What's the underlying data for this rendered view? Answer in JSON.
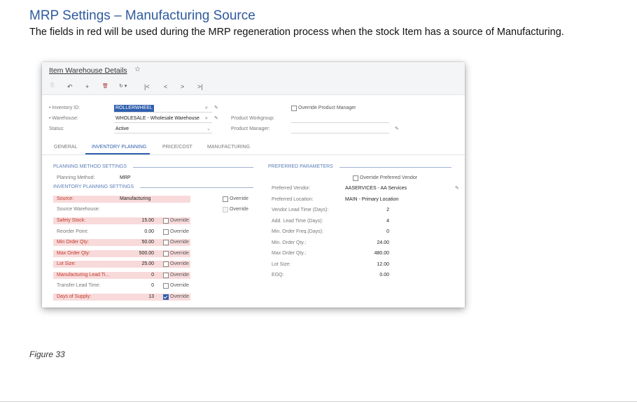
{
  "doc": {
    "title": "MRP Settings – Manufacturing Source",
    "description": "The fields in red will be used during the MRP regeneration process when the stock Item has a source of Manufacturing.",
    "figure_caption": "Figure 33"
  },
  "screen": {
    "title": "Item Warehouse Details",
    "toolbar": [
      "⎘",
      "↶",
      "+",
      "🗑",
      "↻ ▾",
      "|<",
      "<",
      ">",
      ">|"
    ]
  },
  "header_fields": {
    "inventory_id_label": "• Inventory ID:",
    "inventory_id_value": "ROLLERWHEEL",
    "warehouse_label": "• Warehouse:",
    "warehouse_value": "WHOLESALE - Wholesale Warehouse",
    "status_label": "Status:",
    "status_value": "Active",
    "override_product_manager": "Override Product Manager",
    "product_workgroup_label": "Product Workgroup:",
    "product_manager_label": "Product Manager:"
  },
  "tabs": [
    "GENERAL",
    "INVENTORY PLANNING",
    "PRICE/COST",
    "MANUFACTURING"
  ],
  "planning_method": {
    "section": "PLANNING METHOD SETTINGS",
    "label": "Planning Method:",
    "value": "MRP"
  },
  "inventory_planning": {
    "section": "INVENTORY PLANNING SETTINGS",
    "source_label": "Source:",
    "source_value": "Manufacturing",
    "source_override": "Override",
    "source_warehouse_label": "Source Warehouse:",
    "source_warehouse_override": "Override",
    "rows": [
      {
        "label": "Safety Stock:",
        "value": "15.00",
        "override": "Override",
        "red": true,
        "checked": false
      },
      {
        "label": "Reorder Point:",
        "value": "0.00",
        "override": "Override",
        "red": false,
        "checked": false
      },
      {
        "label": "Min Order Qty:",
        "value": "50.00",
        "override": "Override",
        "red": true,
        "checked": false
      },
      {
        "label": "Max Order Qty:",
        "value": "500.00",
        "override": "Override",
        "red": true,
        "checked": false
      },
      {
        "label": "Lot Size:",
        "value": "25.00",
        "override": "Override",
        "red": true,
        "checked": false
      },
      {
        "label": "Manufacturing Lead Ti...",
        "value": "0",
        "override": "Override",
        "red": true,
        "checked": false
      },
      {
        "label": "Transfer Lead Time:",
        "value": "0",
        "override": "Override",
        "red": false,
        "checked": false
      },
      {
        "label": "Days of Supply:",
        "value": "13",
        "override": "Override",
        "red": true,
        "checked": true
      }
    ]
  },
  "preferred": {
    "section": "PREFERRED PARAMETERS",
    "override_vendor": "Override Preferred Vendor",
    "rows": [
      {
        "label": "Preferred Vendor:",
        "value": "AASERVICES - AA Services"
      },
      {
        "label": "Preferred Location:",
        "value": "MAIN - Primary Location"
      },
      {
        "label": "Vendor Lead Time (Days):",
        "value": "2"
      },
      {
        "label": "Add. Lead Time (Days):",
        "value": "4"
      },
      {
        "label": "Min. Order Freq.(Days):",
        "value": "0"
      },
      {
        "label": "Min. Order Qty.:",
        "value": "24.00"
      },
      {
        "label": "Max Order Qty.:",
        "value": "480.00"
      },
      {
        "label": "Lot Size:",
        "value": "12.00"
      },
      {
        "label": "EOQ:",
        "value": "0.00"
      }
    ]
  },
  "colors": {
    "accent": "#2f5fae",
    "required_red": "#c0392b",
    "red_row_bg": "#f8dada",
    "title_blue": "#2e5a9c"
  }
}
